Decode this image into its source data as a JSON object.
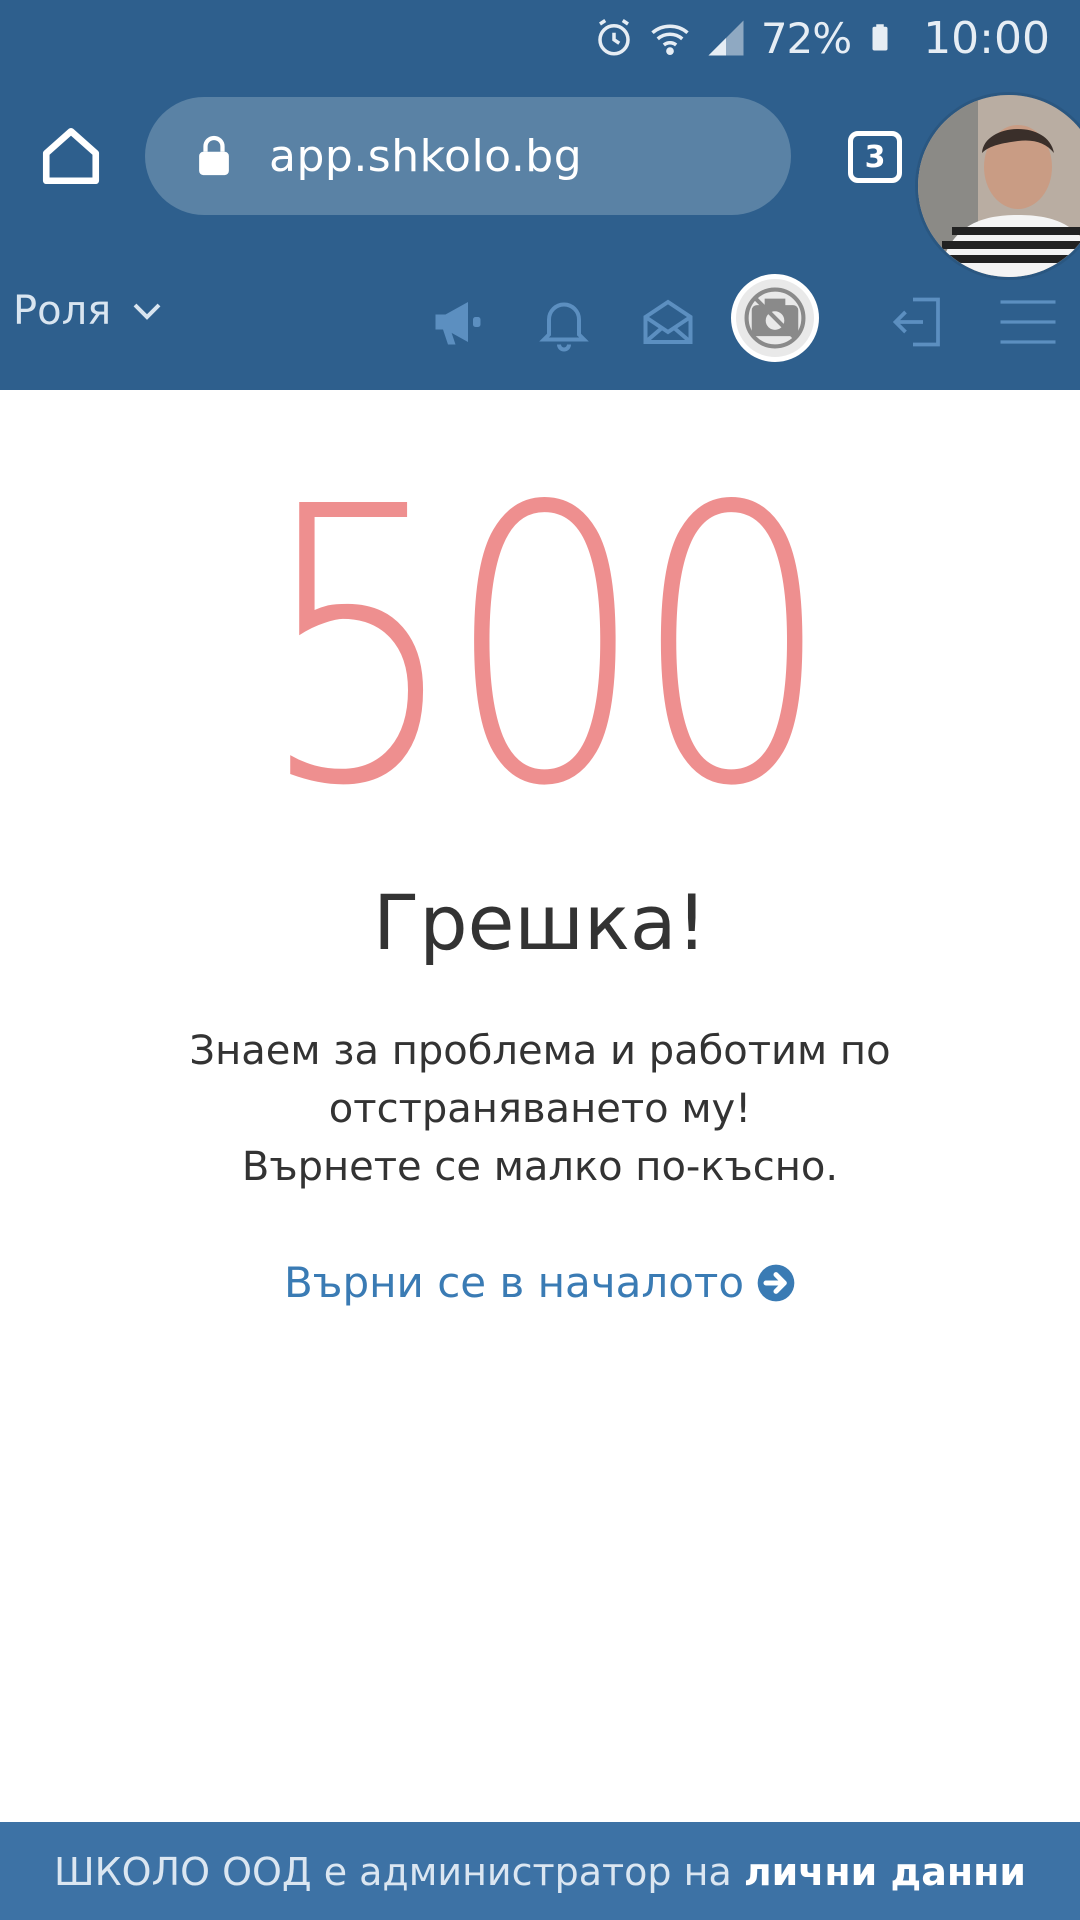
{
  "status_bar": {
    "battery_percent": "72%",
    "time": "10:00"
  },
  "browser": {
    "url": "app.shkolo.bg",
    "tab_count": "3"
  },
  "nav": {
    "role_label": "Роля"
  },
  "error": {
    "code": "500",
    "title": "Грешка!",
    "message_line1": "Знаем за проблема и работим по",
    "message_line2": "отстраняването му!",
    "message_line3": "Върнете се малко по-късно.",
    "back_link": "Върни се в началото"
  },
  "footer": {
    "text": "ШКОЛО ООД е администратор на ",
    "bold_text": "лични данни"
  },
  "colors": {
    "header_bg": "#2e5f8d",
    "error_code": "#ee8f8f",
    "link": "#3a7bb4",
    "footer_bg": "#3d72a5"
  }
}
